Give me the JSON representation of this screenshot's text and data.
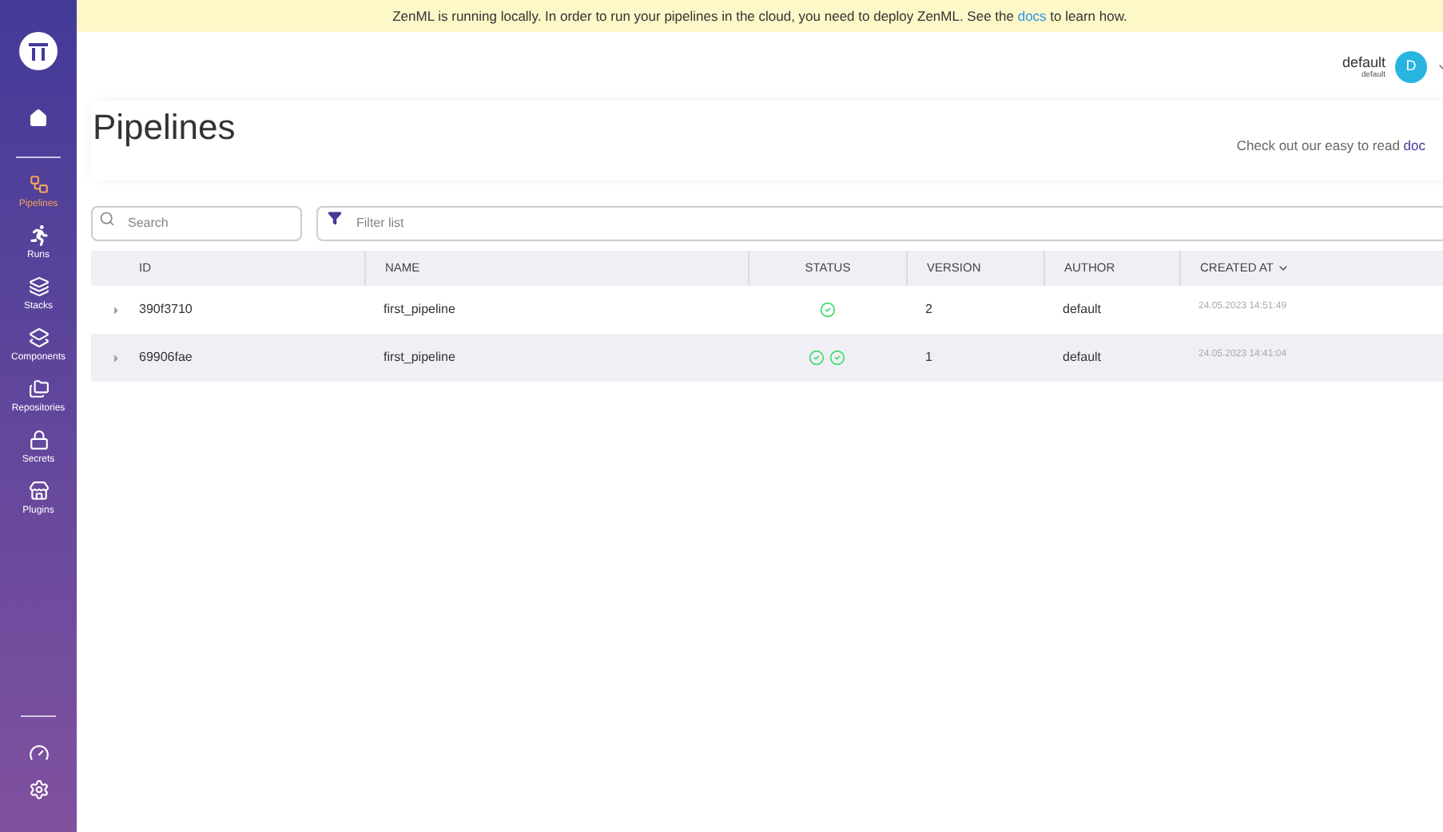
{
  "banner": {
    "before": "ZenML is running locally. In order to run your pipelines in the cloud, you need to deploy ZenML. See the ",
    "link": "docs",
    "after": " to learn how."
  },
  "sidebar": {
    "items": [
      {
        "label": "Pipelines",
        "kind": "pipelines",
        "selected": true
      },
      {
        "label": "Runs",
        "kind": "runs",
        "selected": false
      },
      {
        "label": "Stacks",
        "kind": "stacks",
        "selected": false
      },
      {
        "label": "Components",
        "kind": "components",
        "selected": false
      },
      {
        "label": "Repositories",
        "kind": "repositories",
        "selected": false
      },
      {
        "label": "Secrets",
        "kind": "secrets",
        "selected": false
      },
      {
        "label": "Plugins",
        "kind": "plugins",
        "selected": false
      }
    ]
  },
  "user": {
    "name": "default",
    "workspace": "default",
    "initial": "D"
  },
  "page": {
    "title": "Pipelines",
    "hint": "Check out our easy to read ",
    "hint_link": "doc"
  },
  "search": {
    "placeholder": "Search"
  },
  "filter": {
    "placeholder": "Filter list"
  },
  "table": {
    "columns": [
      "ID",
      "NAME",
      "STATUS",
      "VERSION",
      "AUTHOR",
      "CREATED AT"
    ],
    "rows": [
      {
        "id": "390f3710",
        "name": "first_pipeline",
        "statuses": [
          {
            "kind": "completed"
          }
        ],
        "version": "2",
        "author": "default",
        "created_at": "24.05.2023 14:51:49"
      },
      {
        "id": "69906fae",
        "name": "first_pipeline",
        "statuses": [
          {
            "kind": "completed"
          },
          {
            "kind": "completed"
          }
        ],
        "version": "1",
        "author": "default",
        "created_at": "24.05.2023 14:41:04"
      }
    ]
  }
}
